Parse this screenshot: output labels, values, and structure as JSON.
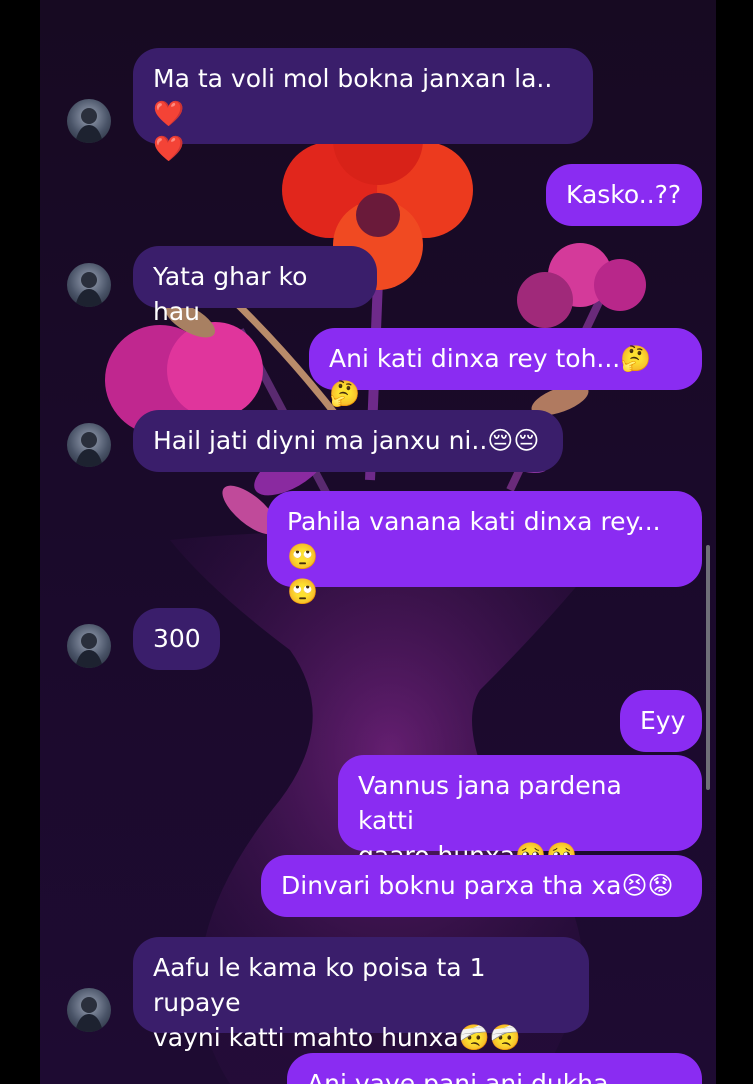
{
  "messages": [
    {
      "dir": "in",
      "text": "Ma ta voli mol bokna janxan la.. ❤️\n❤️"
    },
    {
      "dir": "out",
      "text": "Kasko..??"
    },
    {
      "dir": "in",
      "text": "Yata ghar ko hau"
    },
    {
      "dir": "out",
      "text": "Ani kati dinxa rey toh...🤔🤔"
    },
    {
      "dir": "in",
      "text": "Hail jati diyni ma janxu ni..😔😔"
    },
    {
      "dir": "out",
      "text": "Pahila vanana kati dinxa rey...🙄\n🙄"
    },
    {
      "dir": "in",
      "text": "300"
    },
    {
      "dir": "out",
      "text": "Eyy"
    },
    {
      "dir": "out",
      "text": "Vannus jana pardena katti\ngaaro hunxa🥺🥺"
    },
    {
      "dir": "out",
      "text": "Dinvari boknu parxa tha xa😣😟"
    },
    {
      "dir": "in",
      "text": "Aafu le kama ko poisa ta 1 rupaye\nvayni katti mahto hunxa🤕🤕"
    },
    {
      "dir": "out",
      "text": "Ani vaye pani ani dukha hunxa"
    }
  ],
  "colors": {
    "incoming_bubble": "#3a1e6b",
    "outgoing_bubble": "#8a2cf2",
    "background": "#1a0a2a"
  }
}
